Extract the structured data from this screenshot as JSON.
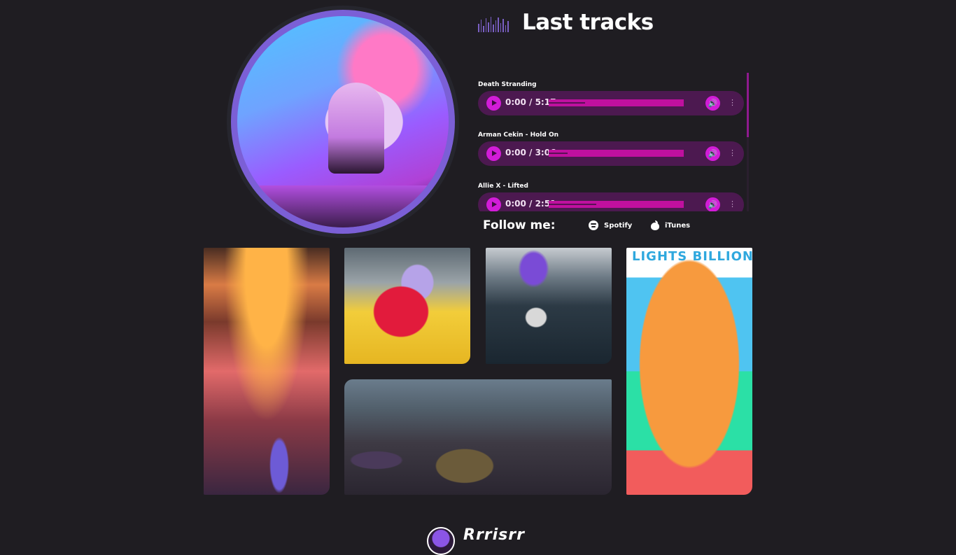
{
  "header": {
    "title": "Last tracks"
  },
  "tracks": [
    {
      "name": "Death Stranding",
      "time": "0:00 / 5:17",
      "progress": 0.27
    },
    {
      "name": "Arman Cekin - Hold On",
      "time": "0:00 / 3:06",
      "progress": 0.14
    },
    {
      "name": "Allie X - Lifted",
      "time": "0:00 / 2:51",
      "progress": 0.35
    }
  ],
  "follow": {
    "label": "Follow me:",
    "links": [
      {
        "label": "Spotify",
        "icon": "spotify-icon"
      },
      {
        "label": "iTunes",
        "icon": "apple-icon"
      }
    ]
  },
  "gallery": {
    "poster_text": "LIGHTS BILLION D"
  },
  "footer": {
    "logo": "Rrrisrr"
  },
  "colors": {
    "background": "#1f1d22",
    "accent": "#d21cd8",
    "player_bg": "#4c1950",
    "ring": "#7b5fd6"
  }
}
